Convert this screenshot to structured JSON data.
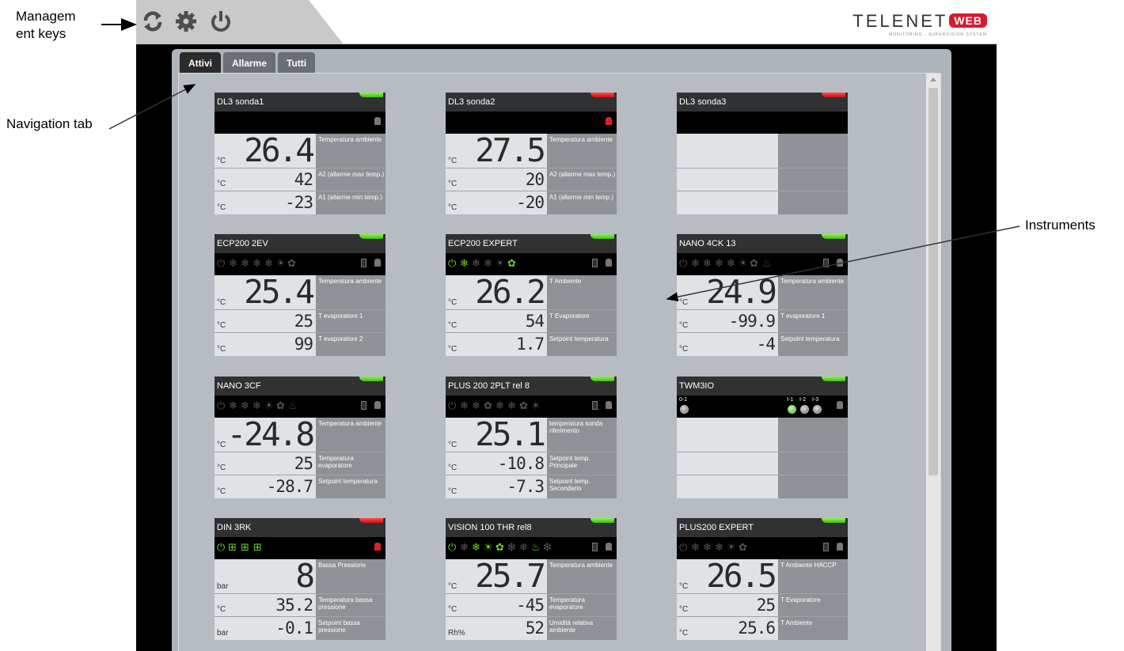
{
  "callouts": {
    "management_keys": "Managem ent keys",
    "navigation_tab": "Navigation tab",
    "instruments": "Instruments"
  },
  "toolbar": {
    "refresh_icon": "refresh-icon",
    "settings_icon": "gear-icon",
    "power_icon": "power-icon"
  },
  "logo": {
    "main": "TELENET",
    "badge": "WEB",
    "sub": "MONITORING - SUPERVISION SYSTEM"
  },
  "tabs": [
    {
      "label": "Attivi",
      "active": true
    },
    {
      "label": "Allarme",
      "active": false
    },
    {
      "label": "Tutti",
      "active": false
    }
  ],
  "colors": {
    "status_ok": "#3fbf16",
    "status_alarm": "#d60f0f",
    "icon_active": "#6fd22c",
    "brand_red": "#d9192d"
  },
  "instruments": [
    {
      "name": "DL3 sonda1",
      "status": "ok",
      "main": {
        "unit": "°C",
        "value": "26.4",
        "desc": "Temperatura ambiente"
      },
      "s1": {
        "unit": "°C",
        "value": "42",
        "desc": "A2 (allarme max temp.)"
      },
      "s2": {
        "unit": "°C",
        "value": "-23",
        "desc": "A1 (allarme min temp.)"
      }
    },
    {
      "name": "DL3 sonda2",
      "status": "alarm",
      "main": {
        "unit": "°C",
        "value": "27.5",
        "desc": "Temperatura ambiente"
      },
      "s1": {
        "unit": "°C",
        "value": "20",
        "desc": "A2 (allarme max temp.)"
      },
      "s2": {
        "unit": "°C",
        "value": "-20",
        "desc": "A1 (allarme min temp.)"
      }
    },
    {
      "name": "DL3 sonda3",
      "status": "alarm",
      "main": {
        "unit": "",
        "value": "",
        "desc": ""
      },
      "s1": {
        "unit": "",
        "value": "",
        "desc": ""
      },
      "s2": {
        "unit": "",
        "value": "",
        "desc": ""
      }
    },
    {
      "name": "ECP200 2EV",
      "status": "ok",
      "main": {
        "unit": "°C",
        "value": "25.4",
        "desc": "Temperatura ambiente"
      },
      "s1": {
        "unit": "°C",
        "value": "25",
        "desc": "T evaporatore 1"
      },
      "s2": {
        "unit": "°C",
        "value": "99",
        "desc": "T evaporatore 2"
      }
    },
    {
      "name": "ECP200 EXPERT",
      "status": "ok",
      "main": {
        "unit": "°C",
        "value": "26.2",
        "desc": "T Ambiente"
      },
      "s1": {
        "unit": "°C",
        "value": "54",
        "desc": "T Evaporatore"
      },
      "s2": {
        "unit": "°C",
        "value": "1.7",
        "desc": "Setpoint temperatura"
      }
    },
    {
      "name": "NANO 4CK 13",
      "status": "ok",
      "main": {
        "unit": "°C",
        "value": "24.9",
        "desc": "Temperatura ambiente"
      },
      "s1": {
        "unit": "°C",
        "value": "-99.9",
        "desc": "T evaporatore 1"
      },
      "s2": {
        "unit": "°C",
        "value": "-4",
        "desc": "Setpoint temperatura"
      }
    },
    {
      "name": "NANO 3CF",
      "status": "ok",
      "main": {
        "unit": "°C",
        "value": "-24.8",
        "desc": "Temperatura ambiente"
      },
      "s1": {
        "unit": "°C",
        "value": "25",
        "desc": "Temperatura evaporatore"
      },
      "s2": {
        "unit": "°C",
        "value": "-28.7",
        "desc": "Setpoint temperatura"
      }
    },
    {
      "name": "PLUS 200 2PLT rel 8",
      "status": "ok",
      "main": {
        "unit": "°C",
        "value": "25.1",
        "desc": "temperatura sonda riferimento"
      },
      "s1": {
        "unit": "°C",
        "value": "-10.8",
        "desc": "Setpoint temp. Principale"
      },
      "s2": {
        "unit": "°C",
        "value": "-7.3",
        "desc": "Setpoint temp. Secondario"
      }
    },
    {
      "name": "TWM3IO",
      "status": "ok",
      "main": {
        "unit": "",
        "value": "",
        "desc": ""
      },
      "s1": {
        "unit": "",
        "value": "",
        "desc": ""
      },
      "s2": {
        "unit": "",
        "value": "",
        "desc": ""
      }
    },
    {
      "name": "DIN 3RK",
      "status": "alarm",
      "main": {
        "unit": "bar",
        "value": "8",
        "desc": "Bassa Pressione"
      },
      "s1": {
        "unit": "°C",
        "value": "35.2",
        "desc": "Temperatura bassa pressione"
      },
      "s2": {
        "unit": "bar",
        "value": "-0.1",
        "desc": "Setpoint bassa pressione"
      }
    },
    {
      "name": "VISION 100 THR rel8",
      "status": "ok",
      "main": {
        "unit": "°C",
        "value": "25.7",
        "desc": "Temperatura ambiente"
      },
      "s1": {
        "unit": "°C",
        "value": "-45",
        "desc": "Temperatura evaporatore"
      },
      "s2": {
        "unit": "Rh%",
        "value": "52",
        "desc": "Umidità relativa ambiente"
      }
    },
    {
      "name": "PLUS200 EXPERT",
      "status": "ok",
      "main": {
        "unit": "°C",
        "value": "26.5",
        "desc": "T Ambiente HACCP"
      },
      "s1": {
        "unit": "°C",
        "value": "25",
        "desc": "T Evaporatore"
      },
      "s2": {
        "unit": "°C",
        "value": "25.6",
        "desc": "T Ambiente"
      }
    }
  ],
  "twm_io": {
    "outputs": [
      "0-1"
    ],
    "inputs": [
      "I-1",
      "I-2",
      "I-3"
    ]
  }
}
